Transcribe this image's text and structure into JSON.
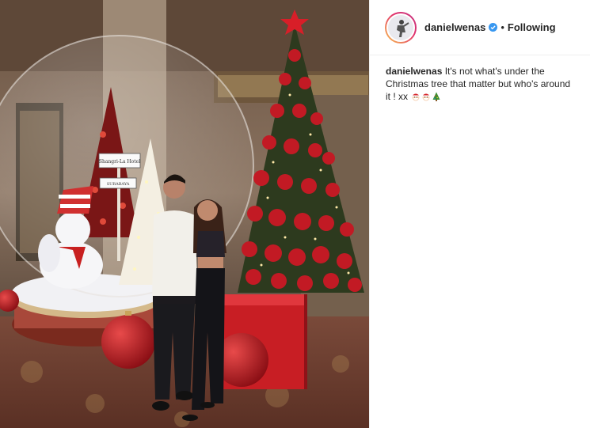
{
  "post": {
    "username": "danielwenas",
    "verified": true,
    "separator": "•",
    "follow_label": "Following",
    "caption_user": "danielwenas",
    "caption_text": " It's not what's under the Christmas tree that matter but who's around it ! xx ",
    "caption_emojis": [
      "santa-emoji",
      "santa-emoji",
      "christmas-tree-emoji"
    ]
  },
  "photo": {
    "sign_line1": "Shangri-La Hotel",
    "sign_line2": "SURABAYA"
  },
  "colors": {
    "verified_blue": "#3897f0",
    "text": "#262626",
    "border": "#efefef",
    "story_ring_start": "#f9c74f",
    "story_ring_end": "#c13584"
  }
}
